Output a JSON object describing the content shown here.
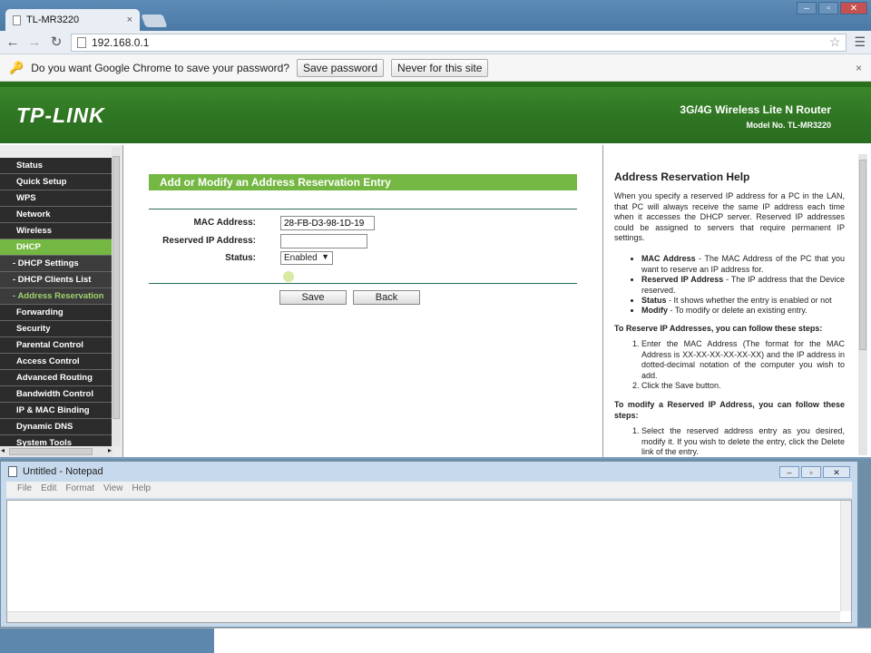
{
  "browser": {
    "tab_title": "TL-MR3220",
    "tab_close": "×",
    "url": "192.168.0.1",
    "win_controls": [
      "–",
      "▫",
      "✕"
    ]
  },
  "infobar": {
    "message": "Do you want Google Chrome to save your password?",
    "save_label": "Save password",
    "never_label": "Never for this site",
    "close": "×"
  },
  "router": {
    "logo": "TP-LINK",
    "product": "3G/4G Wireless Lite N Router",
    "model": "Model No. TL-MR3220",
    "nav": [
      {
        "label": "Status",
        "sub": false,
        "active": false
      },
      {
        "label": "Quick Setup",
        "sub": false,
        "active": false
      },
      {
        "label": "WPS",
        "sub": false,
        "active": false
      },
      {
        "label": "Network",
        "sub": false,
        "active": false
      },
      {
        "label": "Wireless",
        "sub": false,
        "active": false
      },
      {
        "label": "DHCP",
        "sub": false,
        "active": true
      },
      {
        "label": "- DHCP Settings",
        "sub": true,
        "active": false
      },
      {
        "label": "- DHCP Clients List",
        "sub": true,
        "active": false
      },
      {
        "label": "- Address Reservation",
        "sub": true,
        "active": true
      },
      {
        "label": "Forwarding",
        "sub": false,
        "active": false
      },
      {
        "label": "Security",
        "sub": false,
        "active": false
      },
      {
        "label": "Parental Control",
        "sub": false,
        "active": false
      },
      {
        "label": "Access Control",
        "sub": false,
        "active": false
      },
      {
        "label": "Advanced Routing",
        "sub": false,
        "active": false
      },
      {
        "label": "Bandwidth Control",
        "sub": false,
        "active": false
      },
      {
        "label": "IP & MAC Binding",
        "sub": false,
        "active": false
      },
      {
        "label": "Dynamic DNS",
        "sub": false,
        "active": false
      },
      {
        "label": "System Tools",
        "sub": false,
        "active": false
      }
    ],
    "form": {
      "title": "Add or Modify an Address Reservation Entry",
      "mac_label": "MAC Address:",
      "mac_value": "28-FB-D3-98-1D-19",
      "ip_label": "Reserved IP Address:",
      "ip_value": "",
      "status_label": "Status:",
      "status_value": "Enabled",
      "save": "Save",
      "back": "Back"
    },
    "help": {
      "title": "Address Reservation Help",
      "intro": "When you specify a reserved IP address for a PC in the LAN, that PC will always receive the same IP address each time when it accesses the DHCP server. Reserved IP addresses could be assigned to servers that require permanent IP settings.",
      "items": [
        {
          "term": "MAC Address",
          "desc": " - The MAC Address of the PC that you want to reserve an IP address for."
        },
        {
          "term": "Reserved IP Address",
          "desc": " - The IP address that the Device reserved."
        },
        {
          "term": "Status",
          "desc": " - It shows whether the entry is enabled or not"
        },
        {
          "term": "Modify",
          "desc": " - To modify or delete an existing entry."
        }
      ],
      "steps_title": "To Reserve IP Addresses, you can follow these steps:",
      "steps": [
        "Enter the MAC Address (The format for the MAC Address is XX-XX-XX-XX-XX-XX) and the IP address in dotted-decimal notation of the computer you wish to add.",
        "Click the Save button."
      ],
      "modify_title": "To modify a Reserved IP Address, you can follow these steps:",
      "modify_steps": [
        "Select the reserved address entry as you desired, modify it. If you wish to delete the entry, click the Delete link of the entry."
      ]
    }
  },
  "notepad": {
    "title": "Untitled - Notepad",
    "menu": [
      "File",
      "Edit",
      "Format",
      "View",
      "Help"
    ],
    "controls": [
      "–",
      "▫",
      "✕"
    ]
  }
}
